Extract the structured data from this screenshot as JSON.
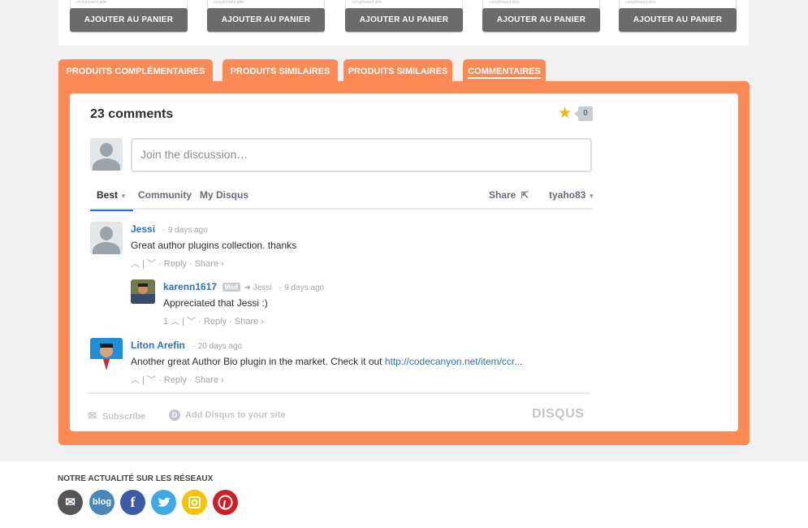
{
  "products": {
    "cart_label": "AJOUTER AU PANIER",
    "tiny_text": "complément alim"
  },
  "tabs": [
    {
      "label": "PRODUITS COMPLÉMENTAIRES"
    },
    {
      "label": "PRODUITS SIMILAIRES"
    },
    {
      "label": "PRODUITS SIMILAIRES"
    },
    {
      "label": "COMMENTAIRES"
    }
  ],
  "disqus": {
    "comment_count": "23 comments",
    "favorites": "0",
    "placeholder": "Join the discussion…",
    "nav": {
      "best": "Best",
      "community": "Community",
      "my_disqus": "My Disqus",
      "share": "Share",
      "user": "tyaho83"
    },
    "comments": [
      {
        "author": "Jessi",
        "time": "9 days ago",
        "text": "Great author plugins collection. thanks",
        "votes": "",
        "reply": "Reply",
        "share": "Share ›"
      },
      {
        "author": "karenn1617",
        "badge": "Mod",
        "reply_to": "Jessi",
        "time": "9 days ago",
        "text": "Appreciated that Jessi :)",
        "votes": "1",
        "reply": "Reply",
        "share": "Share ›"
      },
      {
        "author": "Liton Arefin",
        "time": "20 days ago",
        "text": "Another great Author Bio plugin in the market. Check it out ",
        "link": "http://codecanyon.net/item/ccr...",
        "votes": "",
        "reply": "Reply",
        "share": "Share ›"
      }
    ],
    "footer": {
      "subscribe": "Subscribe",
      "add_disqus": "Add Disqus to your site",
      "logo": "DISQUS"
    }
  },
  "social": {
    "title": "NOTRE ACTUALITÉ SUR LES RÉSEAUX",
    "items": [
      {
        "name": "email",
        "color": "#555555"
      },
      {
        "name": "blog",
        "label": "blog",
        "color": "#4a86b8"
      },
      {
        "name": "facebook",
        "color": "#3b5ba5"
      },
      {
        "name": "twitter",
        "color": "#3fa9e3"
      },
      {
        "name": "instagram",
        "color": "#f2c500"
      },
      {
        "name": "pinterest",
        "color": "#cb2027"
      }
    ]
  },
  "colors": {
    "accent": "#fd8a55",
    "link": "#2e6ebe"
  }
}
